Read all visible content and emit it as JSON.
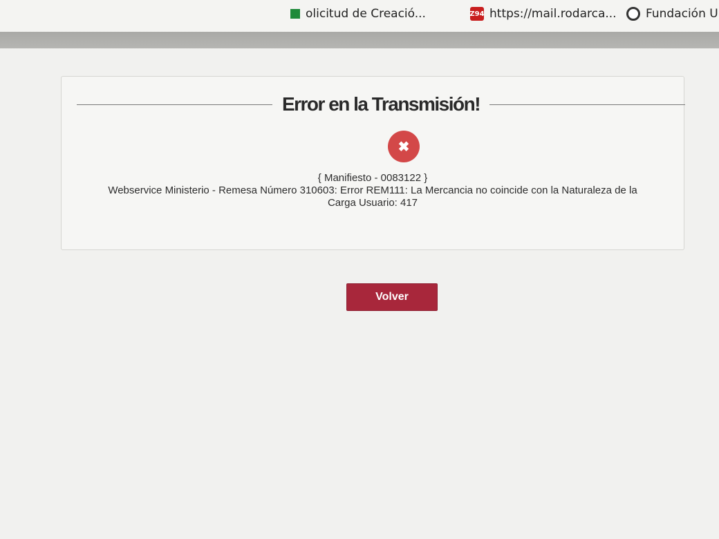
{
  "bookmarks": [
    {
      "label": "olicitud de Creació...",
      "icon": "spreadsheet-icon"
    },
    {
      "label": "https://mail.rodarca...",
      "icon": "zimbra-mail-icon",
      "icon_text": "Z94"
    },
    {
      "label": "Fundación Un",
      "icon": "foundation-logo-icon"
    }
  ],
  "dialog": {
    "title": "Error en la Transmisión!",
    "icon": "error-x-icon",
    "icon_glyph": "✖",
    "message_line1": "{ Manifiesto - 0083122 }",
    "message_line2": "Webservice Ministerio - Remesa Número 310603: Error REM111: La Mercancia no coincide con la Naturaleza de la",
    "message_line3": "Carga Usuario: 417"
  },
  "actions": {
    "back_label": "Volver"
  },
  "colors": {
    "accent": "#a8273b",
    "error_icon": "#d34848"
  }
}
